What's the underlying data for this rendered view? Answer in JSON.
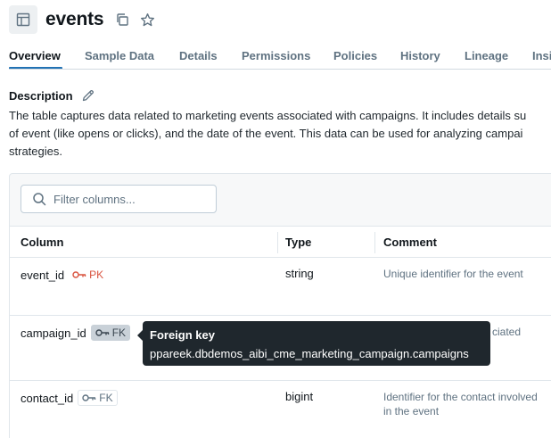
{
  "header": {
    "title": "events"
  },
  "tabs": [
    {
      "label": "Overview"
    },
    {
      "label": "Sample Data"
    },
    {
      "label": "Details"
    },
    {
      "label": "Permissions"
    },
    {
      "label": "Policies"
    },
    {
      "label": "History"
    },
    {
      "label": "Lineage"
    },
    {
      "label": "Insi"
    }
  ],
  "description": {
    "label": "Description",
    "lines": [
      "The table captures data related to marketing events associated with campaigns. It includes details su",
      "of event (like opens or clicks), and the date of the event. This data can be used for analyzing campai",
      "strategies."
    ]
  },
  "filter": {
    "placeholder": "Filter columns..."
  },
  "table": {
    "headers": {
      "column": "Column",
      "type": "Type",
      "comment": "Comment"
    },
    "rows": [
      {
        "name": "event_id",
        "tag": "PK",
        "type": "string",
        "comment": "Unique identifier for the event"
      },
      {
        "name": "campaign_id",
        "tag": "FK",
        "type": "",
        "comment": "ciated"
      },
      {
        "name": "contact_id",
        "tag": "FK",
        "type": "bigint",
        "comment": "Identifier for the contact involved in the event"
      }
    ]
  },
  "tooltip": {
    "title": "Foreign key",
    "body": "ppareek.dbdemos_aibi_cme_marketing_campaign.campaigns"
  },
  "colors": {
    "accent": "#2272b4",
    "pk": "#d9533f",
    "muted": "#5f7281",
    "tooltip_bg": "#1f272d"
  }
}
